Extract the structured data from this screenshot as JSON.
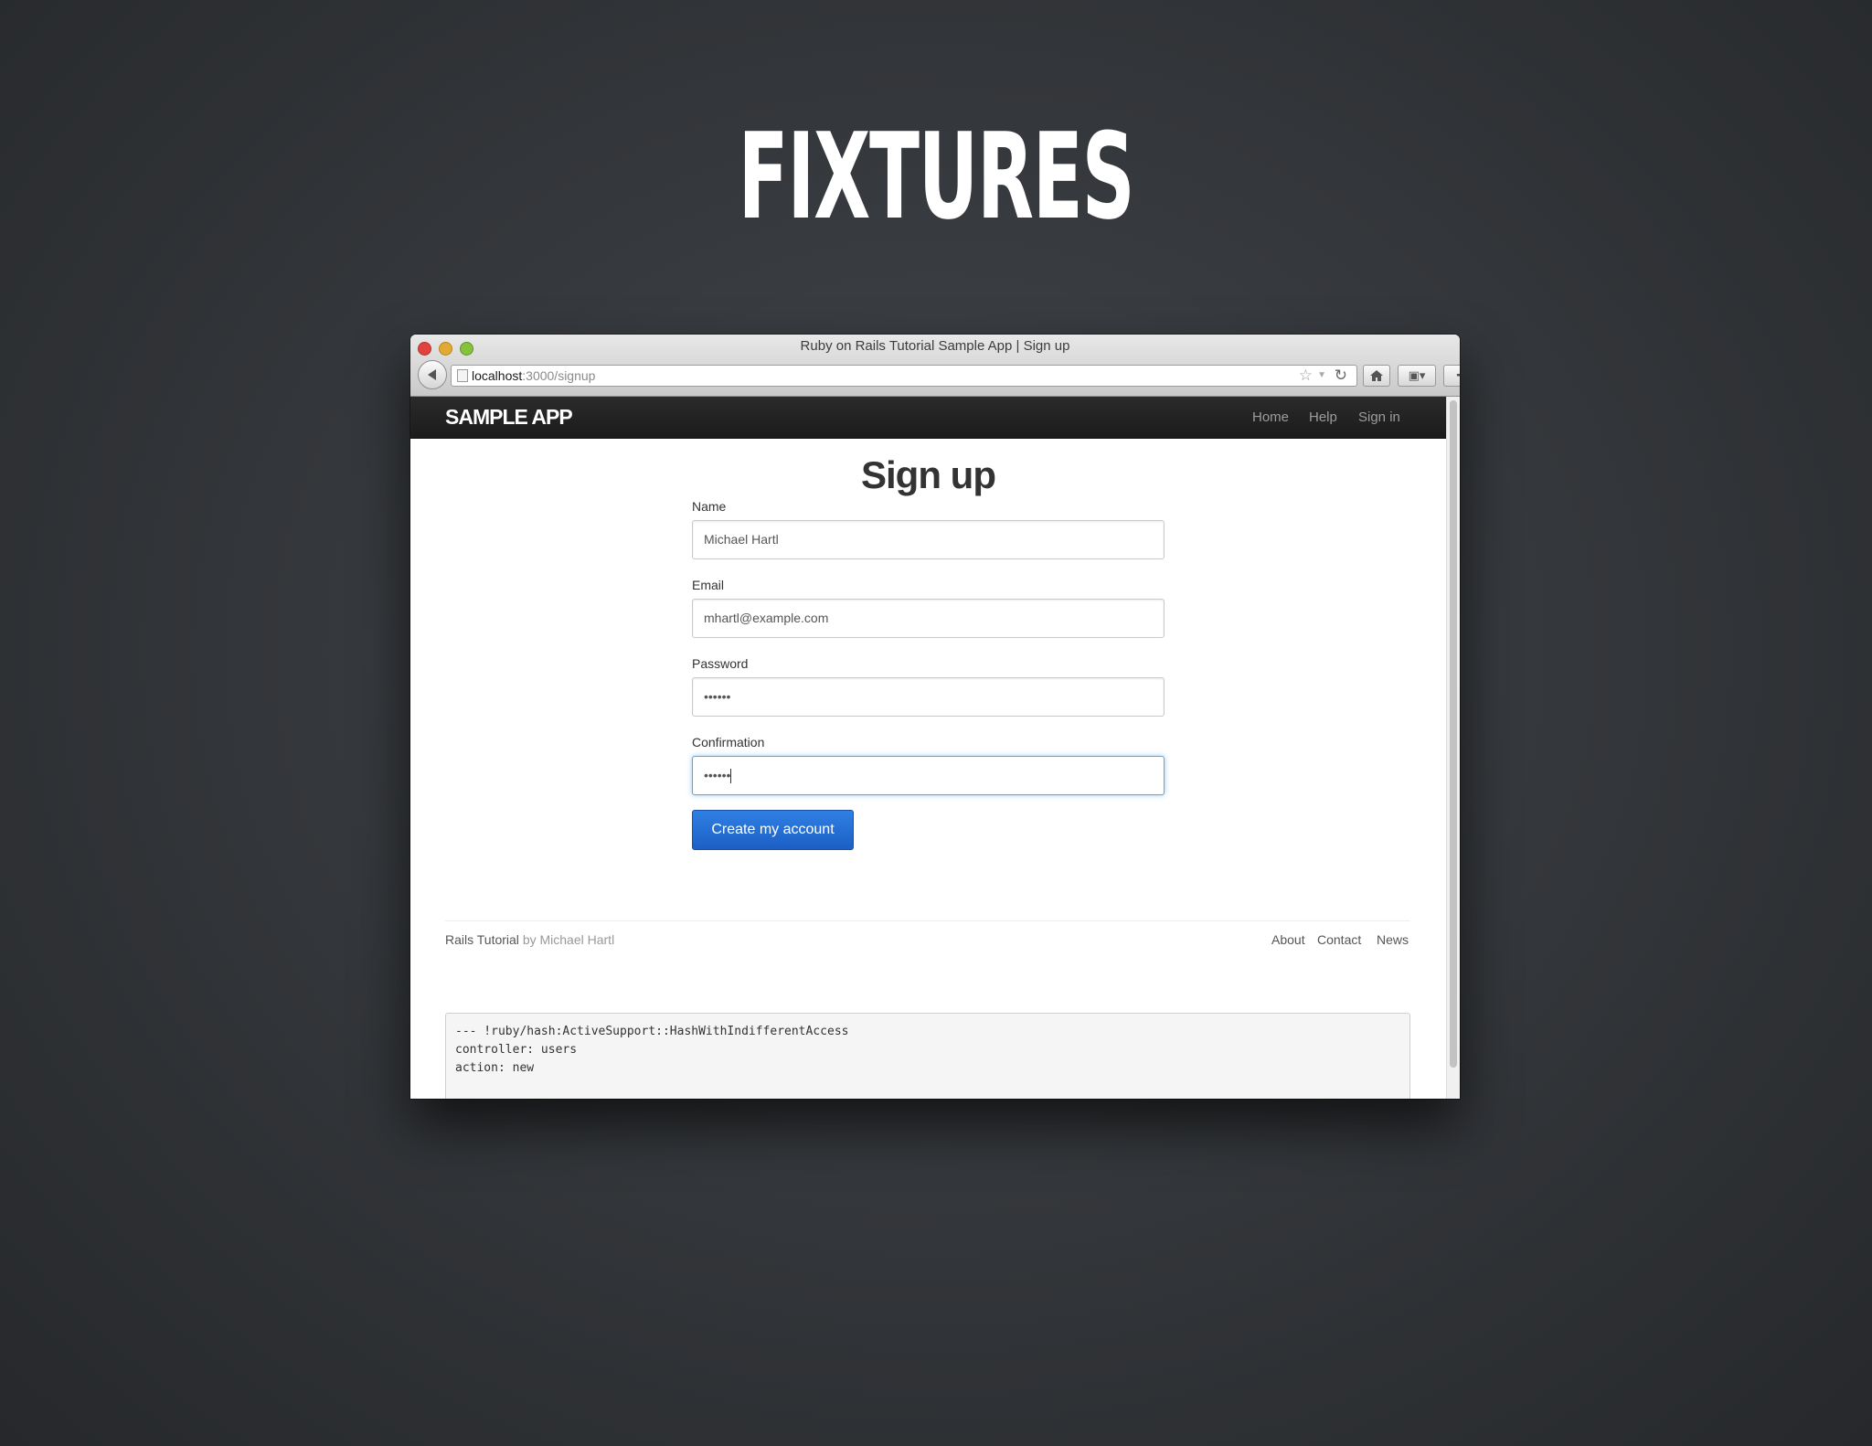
{
  "slide": {
    "title": "FIXTURES"
  },
  "browser": {
    "window_title": "Ruby on Rails Tutorial Sample App | Sign up",
    "url_host": "localhost",
    "url_path": ":3000/signup"
  },
  "navbar": {
    "logo": "SAMPLE APP",
    "links": [
      "Home",
      "Help",
      "Sign in"
    ]
  },
  "form": {
    "heading": "Sign up",
    "fields": [
      {
        "label": "Name",
        "value": "Michael Hartl"
      },
      {
        "label": "Email",
        "value": "mhartl@example.com"
      },
      {
        "label": "Password",
        "value": "••••••"
      },
      {
        "label": "Confirmation",
        "value": "••••••"
      }
    ],
    "submit_label": "Create my account"
  },
  "footer": {
    "left_link": "Rails Tutorial",
    "left_by": "by Michael Hartl",
    "links": [
      "About",
      "Contact",
      "News"
    ]
  },
  "debug": {
    "lines": [
      "--- !ruby/hash:ActiveSupport::HashWithIndifferentAccess",
      "controller: users",
      "action: new"
    ]
  },
  "colors": {
    "primary_button": "#2f80e4",
    "navbar": "#222222",
    "focus_ring": "#52a8ec"
  }
}
